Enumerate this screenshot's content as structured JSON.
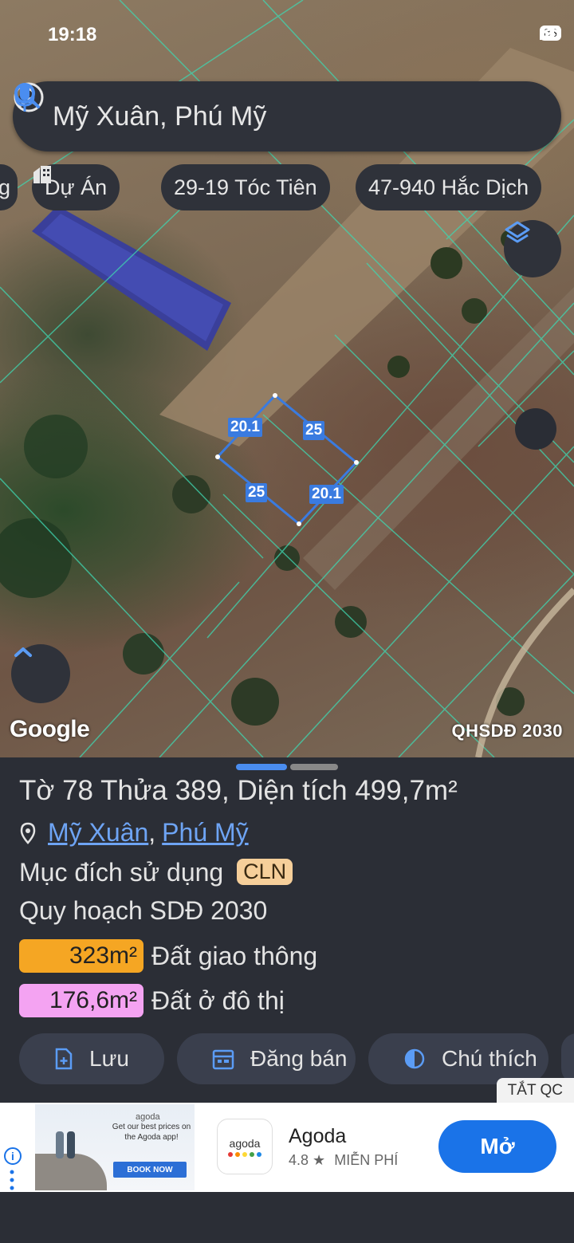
{
  "status": {
    "time": "19:18",
    "battery": "86"
  },
  "search": {
    "text": "Mỹ Xuân, Phú Mỹ"
  },
  "chips": [
    {
      "label": "g"
    },
    {
      "label": "Dự Án"
    },
    {
      "label": "29-19 Tóc Tiên"
    },
    {
      "label": "47-940 Hắc Dịch"
    }
  ],
  "map": {
    "logo": "Google",
    "layer": "QHSDĐ 2030",
    "edge_labels": [
      "20.1",
      "25",
      "25",
      "20.1"
    ],
    "parcel_color": "#3a7be0"
  },
  "parcel": {
    "to_label": "Tờ",
    "to_value": "78",
    "thua_label": "Thửa",
    "thua_value": "389",
    "area_label": "Diện tích",
    "area_value": "499,7m²",
    "commune": "Mỹ Xuân",
    "separator": ",",
    "town": "Phú Mỹ",
    "purpose_label": "Mục đích sử dụng",
    "purpose_code": "CLN",
    "plan_title": "Quy hoạch SDĐ 2030",
    "plans": [
      {
        "area": "323m²",
        "label": "Đất giao thông",
        "color": "#f5a623"
      },
      {
        "area": "176,6m²",
        "label": "Đất ở đô thị",
        "color": "#f4a3f2"
      }
    ]
  },
  "actions": [
    {
      "label": "Lưu",
      "icon": "add-file-icon"
    },
    {
      "label": "Đăng bán",
      "icon": "calendar-icon"
    },
    {
      "label": "Chú thích",
      "icon": "contrast-icon"
    }
  ],
  "ad": {
    "close_label": "TẮT QC",
    "brand_mini": "agoda",
    "tagline": "Get our best prices on the Agoda app!",
    "cta_mini": "BOOK NOW",
    "icon_text": "agoda",
    "name": "Agoda",
    "rating": "4.8",
    "star": "★",
    "price": "MIỄN PHÍ",
    "open_label": "Mở",
    "info": "i"
  }
}
